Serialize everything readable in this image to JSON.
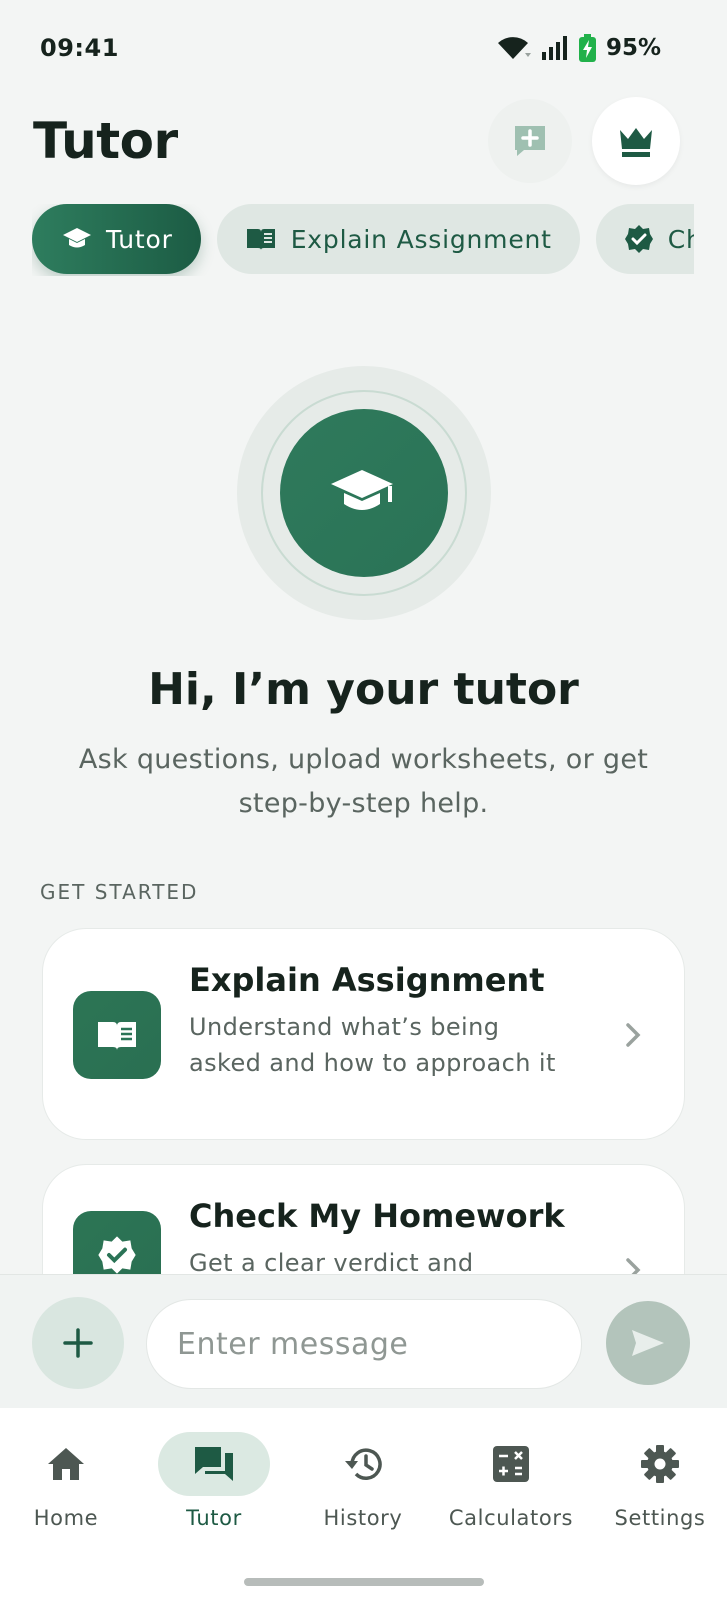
{
  "status_bar": {
    "time": "09:41",
    "battery": "95%",
    "icons": [
      "wifi-icon",
      "signal-icon",
      "battery-charging-icon"
    ]
  },
  "header": {
    "title": "Tutor",
    "actions": [
      "new-chat-icon",
      "crown-icon"
    ]
  },
  "mode_tabs": [
    {
      "label": "Tutor",
      "icon": "graduation-cap-icon",
      "active": true
    },
    {
      "label": "Explain Assignment",
      "icon": "book-icon",
      "active": false
    },
    {
      "label": "Ch",
      "icon": "verified-badge-icon",
      "active": false
    }
  ],
  "hero": {
    "icon": "graduation-cap-icon",
    "greeting": "Hi, I’m your tutor",
    "subtitle": "Ask questions, upload worksheets, or get step-by-step help."
  },
  "get_started": {
    "label": "GET STARTED",
    "cards": [
      {
        "title": "Explain Assignment",
        "description": "Understand what’s being asked and how to approach it",
        "icon": "book-icon"
      },
      {
        "title": "Check My Homework",
        "description": "Get a clear verdict and",
        "icon": "verified-badge-icon"
      }
    ]
  },
  "composer": {
    "placeholder": "Enter message",
    "value": "",
    "attach_icon": "plus-icon",
    "send_icon": "send-icon"
  },
  "bottom_nav": [
    {
      "label": "Home",
      "icon": "home-icon",
      "active": false
    },
    {
      "label": "Tutor",
      "icon": "chat-icon",
      "active": true
    },
    {
      "label": "History",
      "icon": "history-icon",
      "active": false
    },
    {
      "label": "Calculators",
      "icon": "calculator-icon",
      "active": false
    },
    {
      "label": "Settings",
      "icon": "gear-icon",
      "active": false
    }
  ],
  "colors": {
    "accent": "#2a7356",
    "accent_dark": "#1c5c44",
    "background": "#f3f5f4",
    "pill_inactive": "#dfe7e3"
  }
}
